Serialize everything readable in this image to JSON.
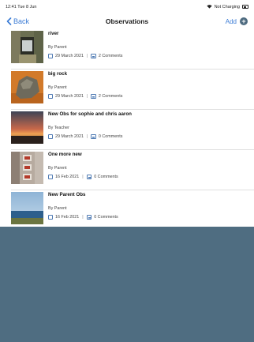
{
  "status_bar": {
    "time_date": "12:41  Tue 8 Jun",
    "battery_text": "Not Charging"
  },
  "nav": {
    "back_label": "Back",
    "title": "Observations",
    "add_label": "Add",
    "add_icon": "+"
  },
  "observations": [
    {
      "title": "river",
      "author": "By Parent",
      "date": "29 March 2021",
      "comments": "2 Comments",
      "thumbnail": "river-photo"
    },
    {
      "title": "big rock",
      "author": "By Parent",
      "date": "29 March 2021",
      "comments": "2 Comments",
      "thumbnail": "rock-photo"
    },
    {
      "title": "New Obs for sophie and chris aaron",
      "author": "By Teacher",
      "date": "29 March 2021",
      "comments": "0 Comments",
      "thumbnail": "sunset-photo"
    },
    {
      "title": "One more new",
      "author": "By Parent",
      "date": "16 Feb 2021",
      "comments": "0 Comments",
      "thumbnail": "food-photo"
    },
    {
      "title": "New Parent Obs",
      "author": "By Parent",
      "date": "16 Feb 2021",
      "comments": "0 Comments",
      "thumbnail": "seascape-photo"
    }
  ],
  "colors": {
    "accent": "#3a7bd5",
    "empty_area": "#4f6d81",
    "icon_blue": "#4e7ab3"
  }
}
